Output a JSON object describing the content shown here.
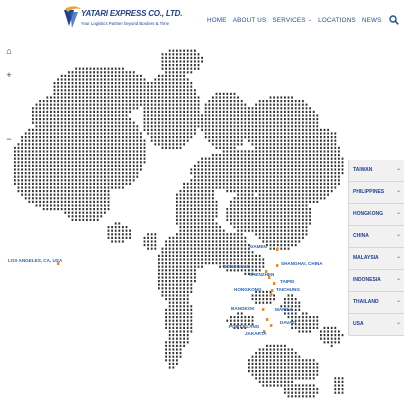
{
  "header": {
    "logo_title": "YATARI EXPRESS CO., LTD.",
    "logo_tagline": "Your Logistics Partner beyond Borders & Time",
    "nav": [
      {
        "label": "HOME"
      },
      {
        "label": "ABOUT US"
      },
      {
        "label": "SERVICES"
      },
      {
        "label": "LOCATIONS"
      },
      {
        "label": "NEWS"
      }
    ]
  },
  "map_controls": {
    "home": "⌂",
    "zoom_in": "+",
    "zoom_out": "−"
  },
  "countries": [
    "TAIWAN",
    "PHILIPPINES",
    "HONGKONG",
    "CHINA",
    "MALAYSIA",
    "INDONESIA",
    "THAILAND",
    "USA"
  ],
  "cities": [
    {
      "label": "LOS ANGELES, CA, USA"
    },
    {
      "label": "XIAMEN"
    },
    {
      "label": "SHANGHAI, CHINA"
    },
    {
      "label": "DONGGUAN"
    },
    {
      "label": "SHENZHEN"
    },
    {
      "label": "TAIPEI"
    },
    {
      "label": "TAICHUNG"
    },
    {
      "label": "HONGKONG"
    },
    {
      "label": "BANGKOK"
    },
    {
      "label": "MANILA"
    },
    {
      "label": "DAVAO"
    },
    {
      "label": "PORT KLANG"
    },
    {
      "label": "JAKARTA"
    }
  ],
  "colors": {
    "brand": "#1f3f8f",
    "nav": "#1f4e9c",
    "city_label": "#2a63b5",
    "marker": "#f08a24",
    "dots": "#333333",
    "panel_bg": "#f1f1f1"
  }
}
